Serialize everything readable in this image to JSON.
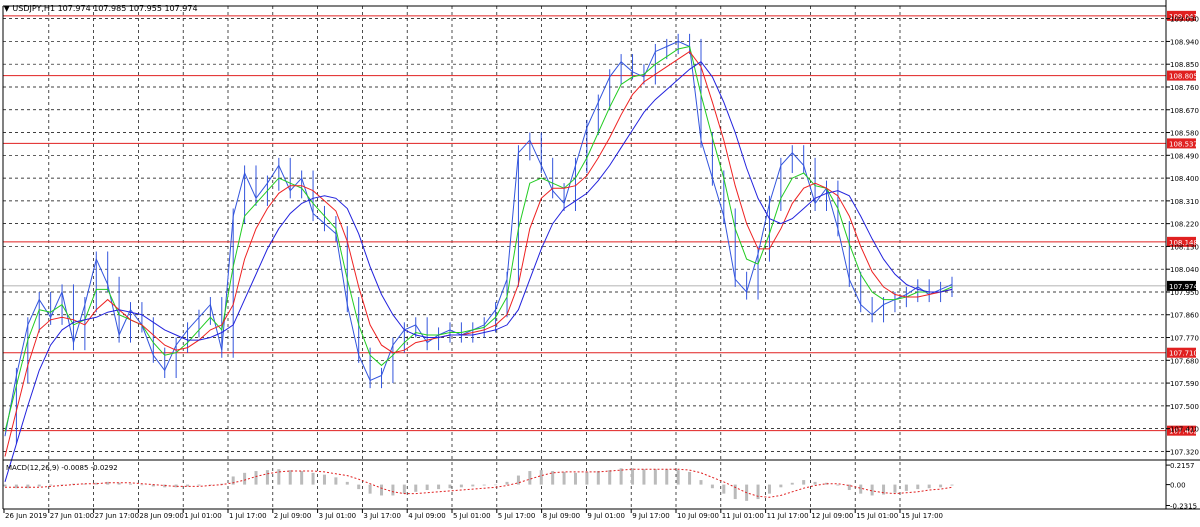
{
  "header": {
    "symbol_line": "USDJPY,H1  107.974 107.985 107.955 107.974",
    "dropdown_icon": "triangle-down-icon"
  },
  "colors": {
    "price": "#3355dd",
    "ma_fast": "#22cc22",
    "ma_mid": "#ee2222",
    "ma_slow": "#2222dd",
    "level_line": "#e02020",
    "level_label_bg": "#e02020",
    "grid": "#000000",
    "macd_hist": "#bbbbbb",
    "macd_signal": "#e02020"
  },
  "chart_data": [
    {
      "type": "line",
      "title": "USDJPY,H1",
      "ohlc_last": {
        "open": 107.974,
        "high": 107.985,
        "low": 107.955,
        "close": 107.974
      },
      "ylim": [
        107.29,
        109.08
      ],
      "y_ticks": [
        "109.030",
        "108.940",
        "108.850",
        "108.760",
        "108.670",
        "108.580",
        "108.490",
        "108.400",
        "108.310",
        "108.220",
        "108.130",
        "108.040",
        "107.950",
        "107.860",
        "107.770",
        "107.680",
        "107.590",
        "107.500",
        "107.410",
        "107.320"
      ],
      "x_ticks": [
        "26 Jun 2019",
        "27 Jun 01:00",
        "27 Jun 17:00",
        "28 Jun 09:00",
        "1 Jul 01:00",
        "1 Jul 17:00",
        "2 Jul 09:00",
        "3 Jul 01:00",
        "3 Jul 17:00",
        "4 Jul 09:00",
        "5 Jul 01:00",
        "5 Jul 17:00",
        "8 Jul 09:00",
        "9 Jul 01:00",
        "9 Jul 17:00",
        "10 Jul 09:00",
        "11 Jul 01:00",
        "11 Jul 17:00",
        "12 Jul 09:00",
        "15 Jul 01:00",
        "15 Jul 17:00"
      ],
      "levels": [
        {
          "label": "109.041",
          "value": 109.041
        },
        {
          "label": "108.805",
          "value": 108.805
        },
        {
          "label": "108.537",
          "value": 108.537
        },
        {
          "label": "108.148",
          "value": 108.148
        },
        {
          "label": "107.710",
          "value": 107.71
        },
        {
          "label": "107.402",
          "value": 107.402
        }
      ],
      "current_price": {
        "label": "107.974",
        "value": 107.974
      },
      "series": [
        {
          "values": [
            107.38,
            107.62,
            107.82,
            107.92,
            107.85,
            107.95,
            107.75,
            107.9,
            108.08,
            107.98,
            107.78,
            107.88,
            107.82,
            107.7,
            107.64,
            107.74,
            107.8,
            107.85,
            107.9,
            107.72,
            108.25,
            108.42,
            108.32,
            108.38,
            108.45,
            108.35,
            108.4,
            108.26,
            108.22,
            108.18,
            107.9,
            107.7,
            107.6,
            107.62,
            107.74,
            107.8,
            107.82,
            107.75,
            107.78,
            107.8,
            107.78,
            107.8,
            107.82,
            107.88,
            108.0,
            108.5,
            108.55,
            108.45,
            108.35,
            108.3,
            108.45,
            108.6,
            108.7,
            108.8,
            108.86,
            108.82,
            108.8,
            108.9,
            108.92,
            108.94,
            108.92,
            108.55,
            108.4,
            108.25,
            108.0,
            107.95,
            108.1,
            108.3,
            108.45,
            108.5,
            108.45,
            108.3,
            108.36,
            108.2,
            108.0,
            107.9,
            107.86,
            107.9,
            107.92,
            107.94,
            107.97,
            107.94,
            107.96,
            107.98
          ]
        },
        {
          "values": [
            107.4,
            107.58,
            107.76,
            107.88,
            107.87,
            107.9,
            107.82,
            107.84,
            107.96,
            107.96,
            107.86,
            107.84,
            107.82,
            107.75,
            107.7,
            107.71,
            107.75,
            107.8,
            107.85,
            107.8,
            108.05,
            108.25,
            108.3,
            108.35,
            108.4,
            108.38,
            108.36,
            108.3,
            108.25,
            108.2,
            108.0,
            107.82,
            107.7,
            107.66,
            107.7,
            107.75,
            107.79,
            107.78,
            107.78,
            107.79,
            107.79,
            107.8,
            107.81,
            107.85,
            107.93,
            108.2,
            108.38,
            108.4,
            108.38,
            108.36,
            108.4,
            108.48,
            108.58,
            108.68,
            108.77,
            108.8,
            108.81,
            108.85,
            108.88,
            108.91,
            108.92,
            108.73,
            108.56,
            108.4,
            108.2,
            108.08,
            108.06,
            108.18,
            108.32,
            108.4,
            108.42,
            108.37,
            108.36,
            108.28,
            108.14,
            108.02,
            107.95,
            107.92,
            107.92,
            107.93,
            107.95,
            107.95,
            107.95,
            107.97
          ]
        },
        {
          "values": [
            107.3,
            107.48,
            107.66,
            107.8,
            107.84,
            107.85,
            107.84,
            107.82,
            107.88,
            107.92,
            107.88,
            107.84,
            107.82,
            107.78,
            107.74,
            107.72,
            107.73,
            107.76,
            107.8,
            107.82,
            107.9,
            108.08,
            108.2,
            108.28,
            108.34,
            108.37,
            108.37,
            108.35,
            108.31,
            108.27,
            108.15,
            107.97,
            107.82,
            107.74,
            107.71,
            107.72,
            107.75,
            107.76,
            107.77,
            107.78,
            107.78,
            107.79,
            107.8,
            107.82,
            107.86,
            107.98,
            108.2,
            108.32,
            108.36,
            108.36,
            108.37,
            108.41,
            108.48,
            108.56,
            108.65,
            108.73,
            108.78,
            108.81,
            108.84,
            108.87,
            108.9,
            108.84,
            108.7,
            108.55,
            108.37,
            108.22,
            108.12,
            108.12,
            108.2,
            108.3,
            108.36,
            108.38,
            108.36,
            108.33,
            108.25,
            108.13,
            108.03,
            107.97,
            107.94,
            107.93,
            107.93,
            107.94,
            107.95,
            107.96
          ]
        },
        {
          "values": [
            107.2,
            107.35,
            107.5,
            107.64,
            107.74,
            107.8,
            107.83,
            107.84,
            107.85,
            107.87,
            107.88,
            107.87,
            107.86,
            107.83,
            107.8,
            107.78,
            107.76,
            107.76,
            107.77,
            107.79,
            107.82,
            107.92,
            108.02,
            108.12,
            108.2,
            108.26,
            108.3,
            108.32,
            108.33,
            108.32,
            108.28,
            108.18,
            108.05,
            107.94,
            107.86,
            107.8,
            107.78,
            107.77,
            107.77,
            107.78,
            107.78,
            107.78,
            107.79,
            107.8,
            107.82,
            107.88,
            108.0,
            108.12,
            108.22,
            108.28,
            108.31,
            108.34,
            108.39,
            108.45,
            108.52,
            108.59,
            108.66,
            108.71,
            108.75,
            108.79,
            108.83,
            108.86,
            108.8,
            108.7,
            108.58,
            108.44,
            108.32,
            108.24,
            108.22,
            108.24,
            108.28,
            108.32,
            108.34,
            108.35,
            108.33,
            108.25,
            108.16,
            108.08,
            108.02,
            107.98,
            107.96,
            107.95,
            107.95,
            107.96
          ]
        }
      ]
    },
    {
      "type": "bar",
      "title": "MACD(12,26,9) -0.0085 -0.0292",
      "ylim": [
        -0.27,
        0.25
      ],
      "y_ticks": [
        "0.2157",
        "0.00",
        "-0.2315"
      ],
      "histogram": [
        -0.02,
        -0.04,
        -0.04,
        -0.02,
        -0.01,
        0.0,
        0.01,
        0.01,
        0.02,
        0.03,
        0.02,
        0.01,
        0.0,
        -0.02,
        -0.03,
        -0.03,
        -0.02,
        -0.01,
        0.0,
        0.01,
        0.09,
        0.13,
        0.15,
        0.16,
        0.17,
        0.16,
        0.15,
        0.13,
        0.11,
        0.08,
        0.03,
        -0.05,
        -0.1,
        -0.12,
        -0.12,
        -0.1,
        -0.08,
        -0.06,
        -0.05,
        -0.04,
        -0.03,
        -0.02,
        -0.01,
        0.0,
        0.03,
        0.1,
        0.15,
        0.16,
        0.15,
        0.14,
        0.13,
        0.14,
        0.15,
        0.16,
        0.18,
        0.18,
        0.17,
        0.17,
        0.17,
        0.16,
        0.14,
        0.05,
        -0.04,
        -0.1,
        -0.16,
        -0.18,
        -0.16,
        -0.1,
        -0.03,
        0.02,
        0.05,
        0.03,
        0.02,
        -0.01,
        -0.06,
        -0.1,
        -0.12,
        -0.11,
        -0.09,
        -0.07,
        -0.05,
        -0.04,
        -0.03,
        -0.01
      ],
      "signal": [
        -0.03,
        -0.03,
        -0.03,
        -0.03,
        -0.02,
        -0.01,
        0.0,
        0.01,
        0.01,
        0.02,
        0.02,
        0.02,
        0.01,
        0.0,
        -0.01,
        -0.02,
        -0.02,
        -0.02,
        -0.01,
        0.0,
        0.02,
        0.05,
        0.09,
        0.12,
        0.14,
        0.15,
        0.15,
        0.15,
        0.14,
        0.12,
        0.1,
        0.06,
        0.01,
        -0.04,
        -0.08,
        -0.1,
        -0.1,
        -0.09,
        -0.08,
        -0.07,
        -0.06,
        -0.05,
        -0.04,
        -0.03,
        -0.01,
        0.02,
        0.06,
        0.1,
        0.13,
        0.14,
        0.14,
        0.14,
        0.14,
        0.15,
        0.16,
        0.17,
        0.17,
        0.17,
        0.17,
        0.17,
        0.16,
        0.13,
        0.08,
        0.03,
        -0.03,
        -0.09,
        -0.13,
        -0.14,
        -0.12,
        -0.08,
        -0.04,
        -0.01,
        0.01,
        0.01,
        -0.01,
        -0.04,
        -0.07,
        -0.09,
        -0.1,
        -0.09,
        -0.08,
        -0.06,
        -0.05,
        -0.03
      ]
    }
  ]
}
